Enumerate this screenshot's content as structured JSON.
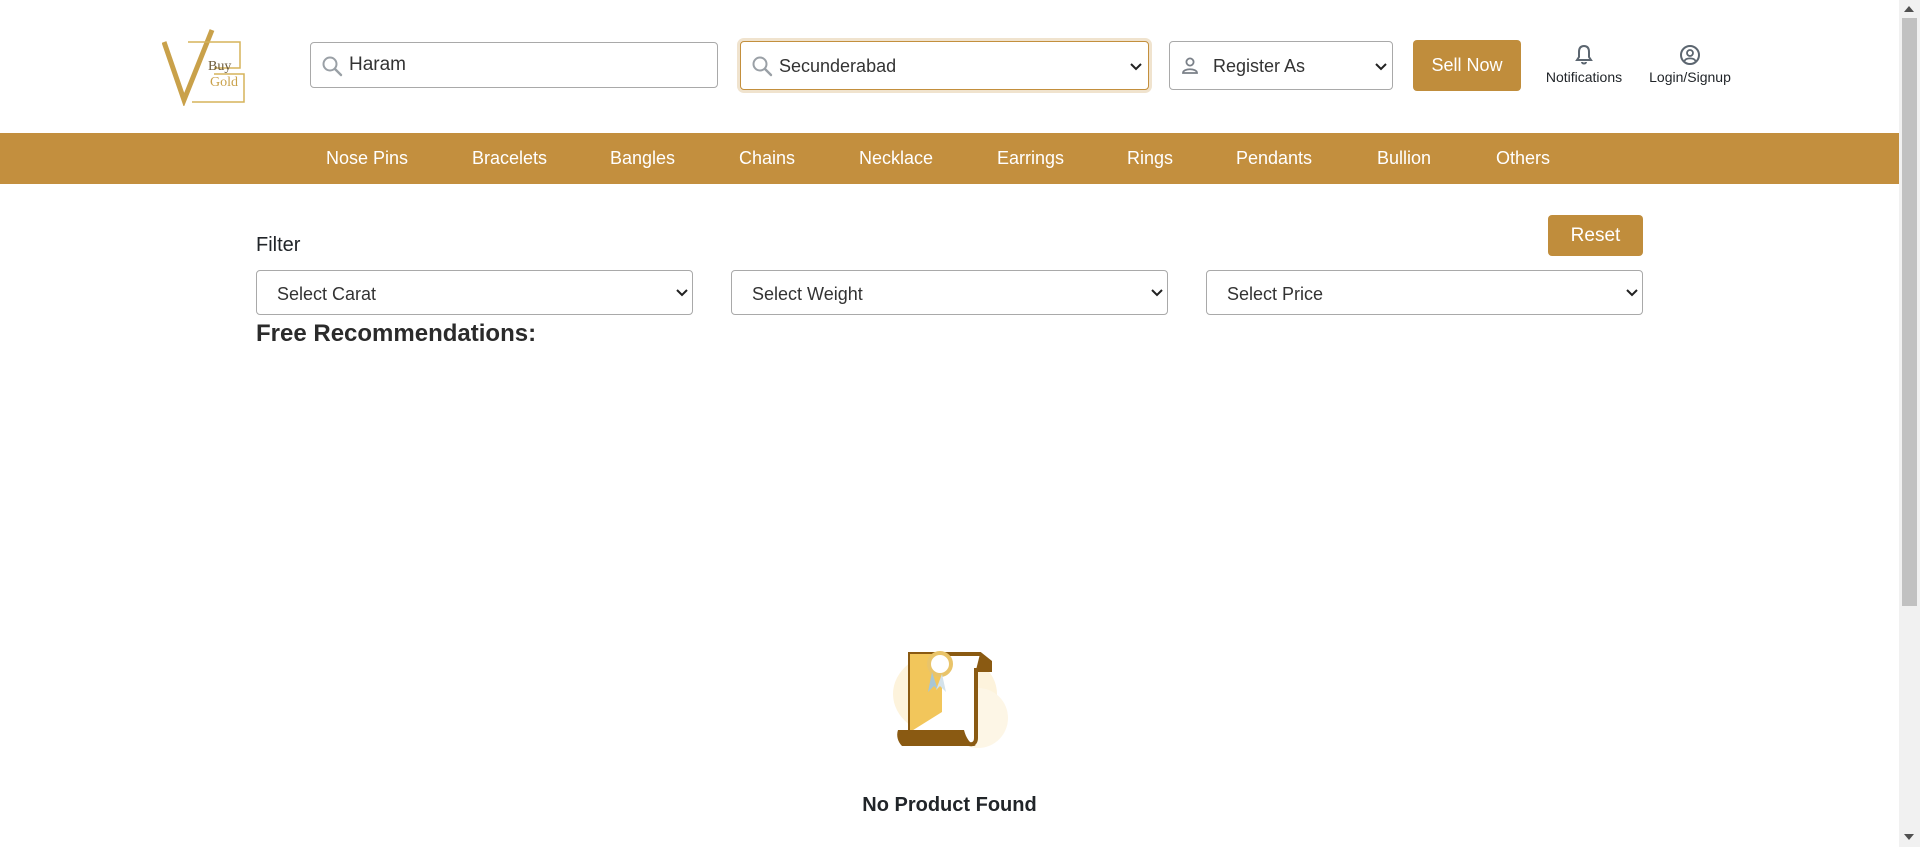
{
  "header": {
    "logo_text_1": "Buy",
    "logo_text_2": "Gold",
    "search": {
      "value": "Haram",
      "placeholder": "Search"
    },
    "city": {
      "selected": "Secunderabad"
    },
    "register": {
      "selected": "Register As"
    },
    "sell_label": "Sell Now",
    "notifications_label": "Notifications",
    "login_label": "Login/Signup"
  },
  "nav": {
    "items": [
      {
        "label": "Nose Pins"
      },
      {
        "label": "Bracelets"
      },
      {
        "label": "Bangles"
      },
      {
        "label": "Chains"
      },
      {
        "label": "Necklace"
      },
      {
        "label": "Earrings"
      },
      {
        "label": "Rings"
      },
      {
        "label": "Pendants"
      },
      {
        "label": "Bullion"
      },
      {
        "label": "Others"
      }
    ]
  },
  "filters": {
    "label": "Filter",
    "reset_label": "Reset",
    "carat": "Select Carat",
    "weight": "Select Weight",
    "price": "Select Price"
  },
  "recommendations": {
    "title": "Free Recommendations:",
    "empty_text": "No Product Found"
  },
  "colors": {
    "brand": "#c38f3e",
    "button": "#c08d3c"
  }
}
